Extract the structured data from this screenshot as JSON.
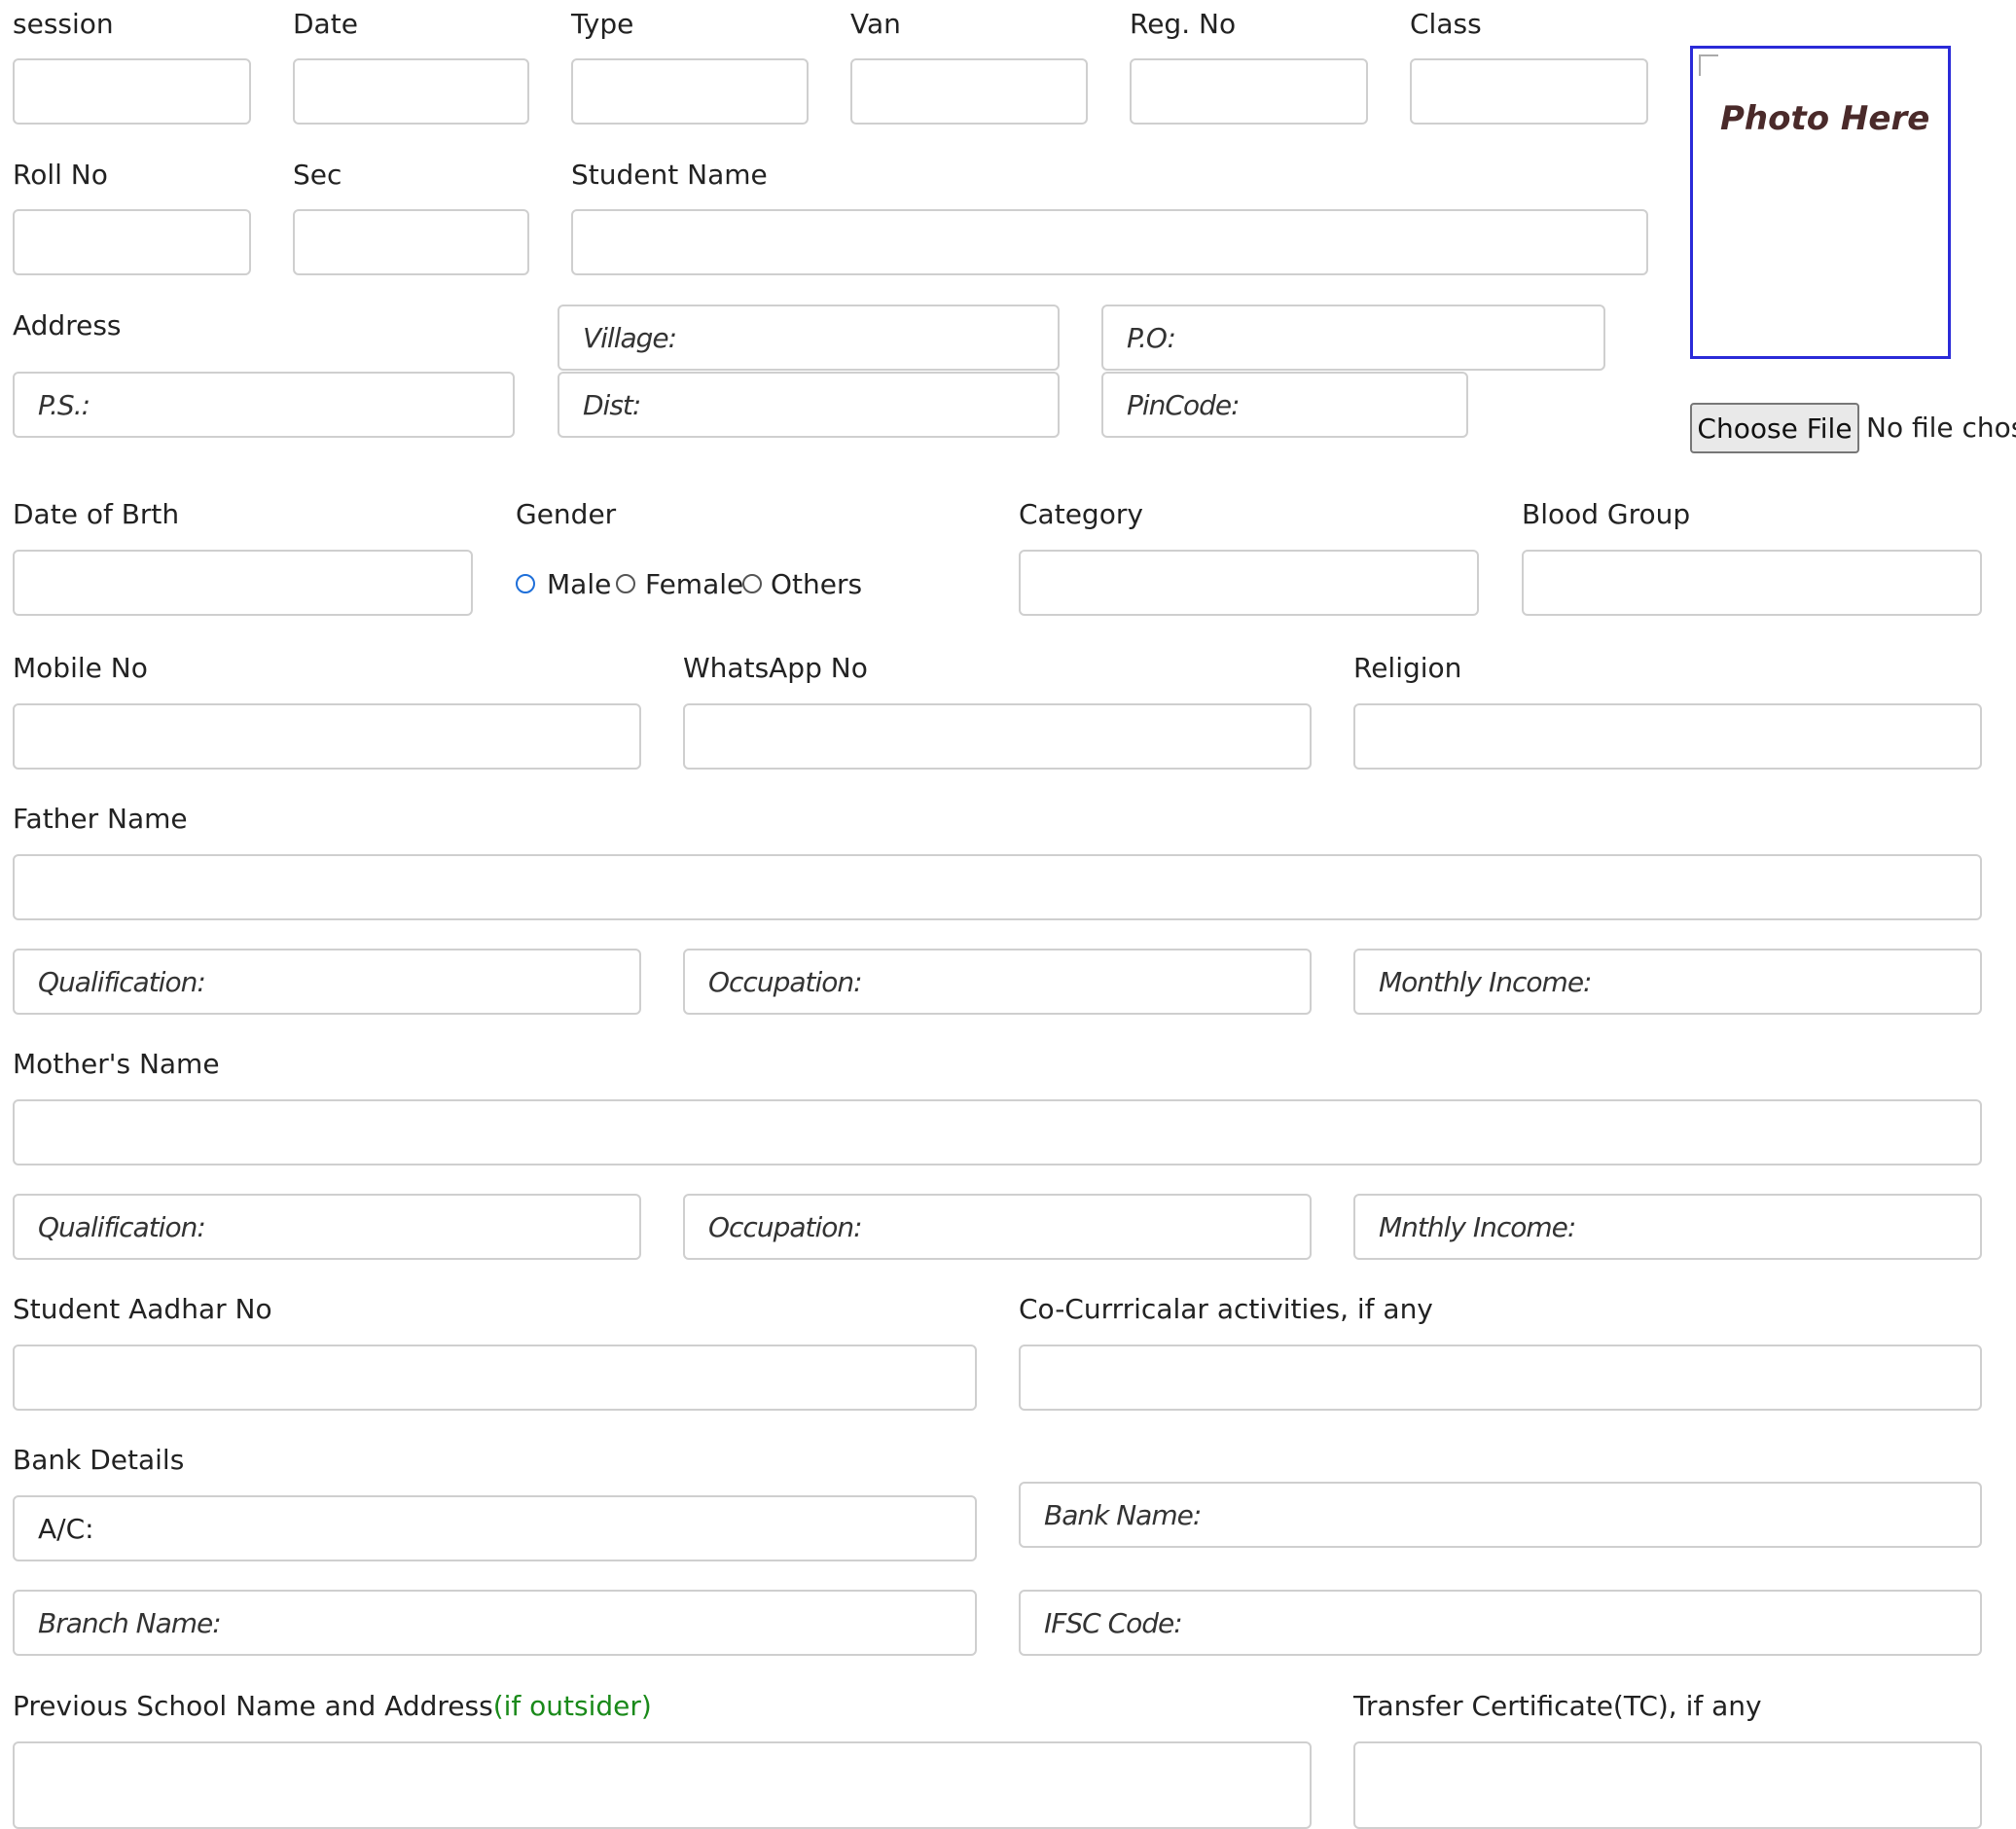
{
  "labels": {
    "session": "session",
    "date": "Date",
    "type": "Type",
    "van": "Van",
    "reg_no": "Reg. No",
    "class": "Class",
    "roll_no": "Roll No",
    "sec": "Sec",
    "student_name": "Student Name",
    "address": "Address",
    "dob": "Date of Brth",
    "gender": "Gender",
    "category": "Category",
    "blood_group": "Blood Group",
    "mobile": "Mobile No",
    "whatsapp": "WhatsApp No",
    "religion": "Religion",
    "father_name": "Father Name",
    "mother_name": "Mother's Name",
    "aadhar": "Student Aadhar No",
    "cocurricular": "Co-Currricalar activities, if any",
    "bank_details": "Bank Details",
    "prev_school": "Previous School Name and Address",
    "prev_school_note": "(if outsider)",
    "tc": "Transfer Certificate(TC), if any"
  },
  "placeholders": {
    "village": "Village:",
    "po": "P.O:",
    "ps": "P.S.:",
    "dist": "Dist:",
    "pincode": "PinCode:",
    "father_qualification": "Qualification:",
    "father_occupation": "Occupation:",
    "father_income": "Monthly Income:",
    "mother_qualification": "Qualification:",
    "mother_occupation": "Occupation:",
    "mother_income": "Mnthly Income:",
    "branch": "Branch Name:",
    "ifsc": "IFSC Code:",
    "bank_name": "Bank Name:"
  },
  "values": {
    "ac": "A/C:"
  },
  "gender_options": {
    "male": "Male",
    "female": "Female",
    "others": "Others"
  },
  "photo": {
    "alt_text": "Photo Here",
    "button_label": "Choose File",
    "status": "No file chos"
  }
}
